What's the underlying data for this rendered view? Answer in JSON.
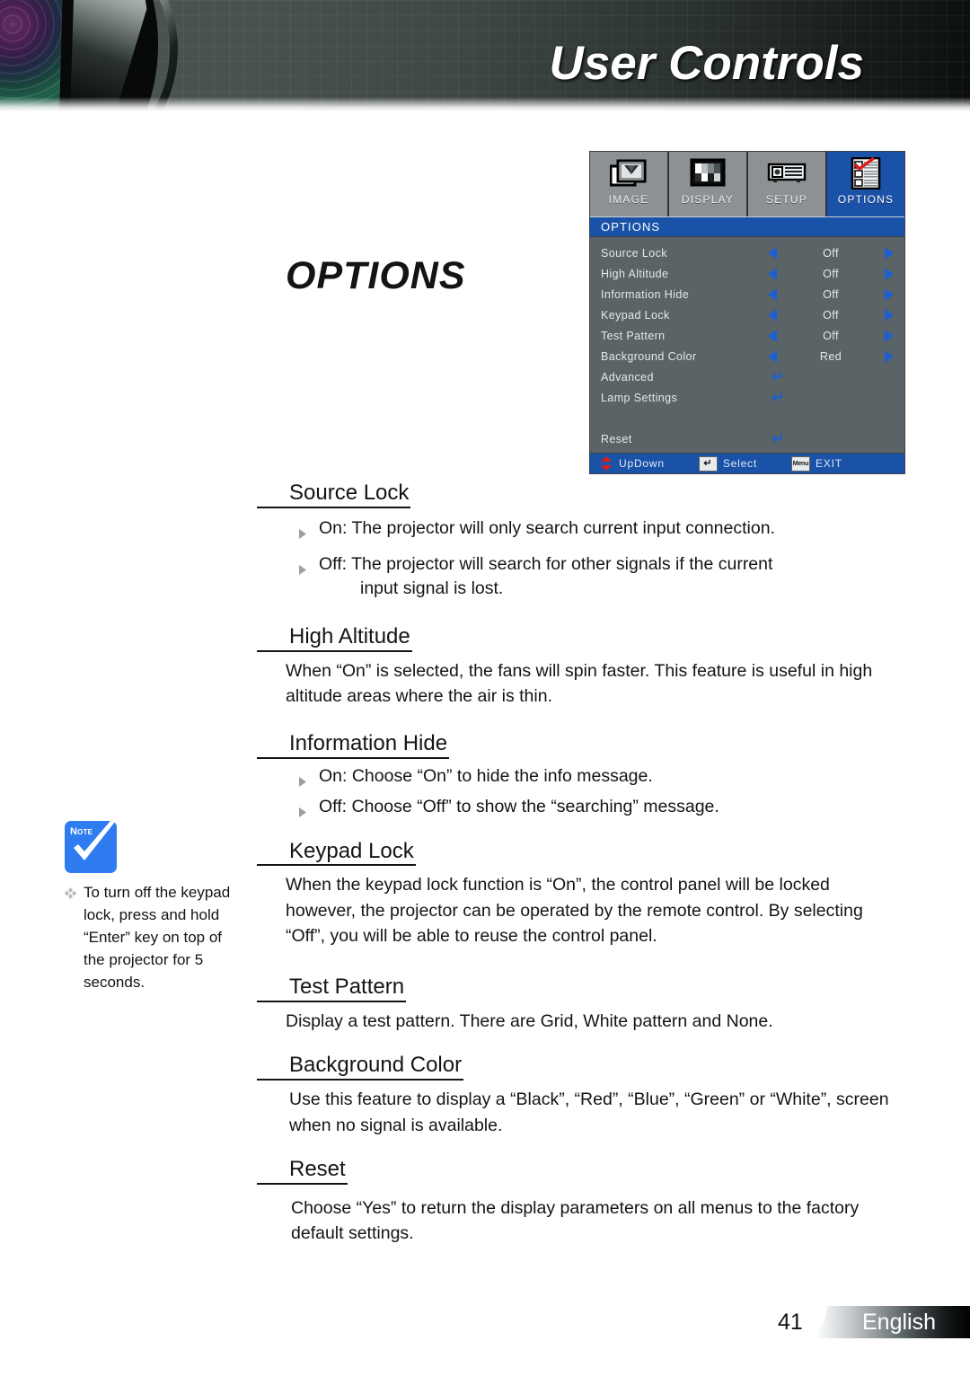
{
  "header": {
    "title": "User Controls",
    "lens_icon": "camera-lens-graphic"
  },
  "page_title": "OPTIONS",
  "osd": {
    "tabs": [
      {
        "label": "IMAGE",
        "icon": "image-tab-icon",
        "active": false
      },
      {
        "label": "DISPLAY",
        "icon": "display-tab-icon",
        "active": false
      },
      {
        "label": "SETUP",
        "icon": "setup-tab-icon",
        "active": false
      },
      {
        "label": "OPTIONS",
        "icon": "options-tab-icon",
        "active": true
      }
    ],
    "menu_header": "OPTIONS",
    "rows": [
      {
        "label": "Source Lock",
        "type": "value",
        "value": "Off"
      },
      {
        "label": "High Altitude",
        "type": "value",
        "value": "Off"
      },
      {
        "label": "Information Hide",
        "type": "value",
        "value": "Off"
      },
      {
        "label": "Keypad Lock",
        "type": "value",
        "value": "Off"
      },
      {
        "label": "Test Pattern",
        "type": "value",
        "value": "Off"
      },
      {
        "label": "Background Color",
        "type": "value",
        "value": "Red"
      },
      {
        "label": "Advanced",
        "type": "enter",
        "value": "↵"
      },
      {
        "label": "Lamp Settings",
        "type": "enter",
        "value": "↵"
      },
      {
        "label": "",
        "type": "blank",
        "value": ""
      },
      {
        "label": "Reset",
        "type": "enter",
        "value": "↵"
      }
    ],
    "footer": [
      {
        "label": "UpDown",
        "icon": "up-down-arrows-icon"
      },
      {
        "label": "Select",
        "icon": "enter-key-icon",
        "key": "↵"
      },
      {
        "label": "EXIT",
        "icon": "menu-key-icon",
        "key": "Menu"
      }
    ],
    "colors": {
      "accent_blue": "#1a52a8",
      "arrow_blue": "#1d5fd0",
      "body_gray": "#5a6365",
      "tab_gray": "#8d9193"
    }
  },
  "sections": [
    {
      "heading": "Source Lock",
      "bullets": [
        {
          "text": "On: The projector will only search current input connection.",
          "cont": ""
        },
        {
          "text": "Off: The projector will search for other signals if the current",
          "cont": "input signal is lost."
        }
      ],
      "paragraphs": []
    },
    {
      "heading": "High Altitude",
      "bullets": [],
      "paragraphs": [
        "When “On” is selected, the fans will spin faster. This feature is useful in high altitude areas where the air is thin."
      ]
    },
    {
      "heading": "Information Hide",
      "bullets": [
        {
          "text": "On: Choose “On” to hide the info message.",
          "cont": ""
        },
        {
          "text": "Off: Choose “Off” to show the “searching” message.",
          "cont": ""
        }
      ],
      "paragraphs": []
    },
    {
      "heading": "Keypad Lock",
      "bullets": [],
      "paragraphs": [
        "When the keypad lock function is “On”, the control panel will be locked however, the projector can be operated by the remote control. By selecting “Off”, you will be able to reuse the control panel."
      ]
    },
    {
      "heading": "Test Pattern",
      "bullets": [],
      "paragraphs": [
        "Display a test pattern. There are Grid, White pattern and None."
      ]
    },
    {
      "heading": "Background Color",
      "bullets": [],
      "paragraphs": [
        "Use this feature to display a “Black”, “Red”, “Blue”, “Green” or “White”, screen when no signal is available."
      ]
    },
    {
      "heading": "Reset",
      "bullets": [],
      "paragraphs": [
        "Choose “Yes” to return the display parameters on all menus to the factory default settings."
      ]
    }
  ],
  "note": {
    "badge_label": "Note",
    "badge_icon": "blue-checkmark-note-icon",
    "bullet_icon": "diamond-cluster-bullet-icon",
    "text": "To turn off the keypad lock, press and hold “Enter” key on top of the projector for 5 seconds.",
    "accent_color": "#2f7cf0"
  },
  "footer": {
    "page_number": "41",
    "language": "English"
  }
}
